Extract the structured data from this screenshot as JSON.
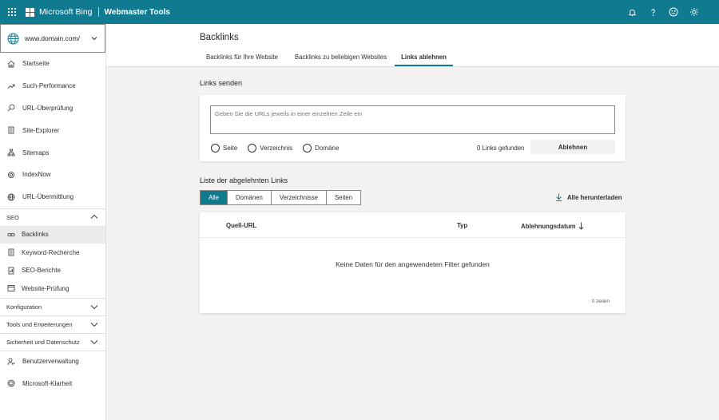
{
  "topbar": {
    "brand": "Microsoft Bing",
    "product": "Webmaster Tools",
    "icons": [
      "bell-icon",
      "help-icon",
      "smiley-icon",
      "gear-icon"
    ]
  },
  "sidebar": {
    "site_url": "www.domain.com/",
    "main_items": [
      {
        "label": "Startseite",
        "icon": "home-icon"
      },
      {
        "label": "Such-Performance",
        "icon": "trend-icon"
      },
      {
        "label": "URL-Überprüfung",
        "icon": "search-icon"
      },
      {
        "label": "Site-Explorer",
        "icon": "document-icon"
      },
      {
        "label": "Sitemaps",
        "icon": "sitemap-icon"
      },
      {
        "label": "IndexNow",
        "icon": "gear-icon"
      },
      {
        "label": "URL-Übermittlung",
        "icon": "globe-icon"
      }
    ],
    "seo_section": {
      "label": "SEO",
      "items": [
        {
          "label": "Backlinks",
          "icon": "link-icon",
          "active": true
        },
        {
          "label": "Keyword-Recherche",
          "icon": "document-icon"
        },
        {
          "label": "SEO-Berichte",
          "icon": "report-icon"
        },
        {
          "label": "Website-Prüfung",
          "icon": "browser-icon"
        }
      ]
    },
    "collapsed_sections": [
      "Konfiguration",
      "Tools und Erweiterungen",
      "Sicherheit und Datenschutz"
    ],
    "bottom_items": [
      {
        "label": "Benutzerverwaltung",
        "icon": "user-icon"
      },
      {
        "label": "Microsoft-Klarheit",
        "icon": "clarity-icon"
      }
    ]
  },
  "main": {
    "title": "Backlinks",
    "tabs": [
      {
        "label": "Backlinks für Ihre Website",
        "active": false
      },
      {
        "label": "Backlinks zu beliebigen Websites",
        "active": false
      },
      {
        "label": "Links ablehnen",
        "active": true
      }
    ],
    "send": {
      "title": "Links senden",
      "placeholder": "Geben Sie die URLs jeweils in einer einzelnen Zeile ein",
      "radios": [
        "Seite",
        "Verzeichnis",
        "Domäne"
      ],
      "links_count": "0 Links gefunden",
      "reject_button": "Ablehnen"
    },
    "list": {
      "title": "Liste der abgelehnten Links",
      "filters": [
        {
          "label": "Alle",
          "active": true
        },
        {
          "label": "Domänen",
          "active": false
        },
        {
          "label": "Verzeichnisse",
          "active": false
        },
        {
          "label": "Seiten",
          "active": false
        }
      ],
      "download_label": "Alle herunterladen",
      "columns": [
        "Quell-URL",
        "Typ",
        "Ablehnungsdatum"
      ],
      "empty_message": "Keine Daten für den angewendeten Filter gefunden",
      "row_count": "0 zeilen"
    }
  }
}
